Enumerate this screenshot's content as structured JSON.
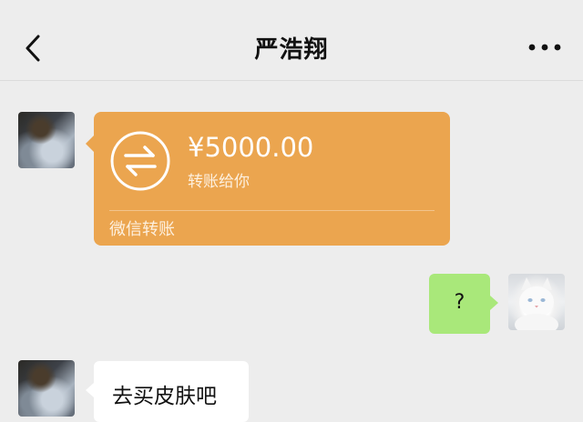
{
  "header": {
    "title": "严浩翔",
    "back_icon": "chevron-left-icon",
    "more_icon": "more-horizontal-icon"
  },
  "messages": [
    {
      "type": "transfer",
      "sender": "contact",
      "amount": "¥5000.00",
      "subtitle": "转账给你",
      "footer": "微信转账",
      "color": "#eba54f"
    },
    {
      "type": "text",
      "sender": "me",
      "text": "?",
      "color": "#a9e87a"
    },
    {
      "type": "text",
      "sender": "contact",
      "text": "去买皮肤吧",
      "color": "#ffffff"
    }
  ],
  "colors": {
    "background": "#ededed",
    "transfer_card": "#eba54f",
    "my_bubble": "#a9e87a",
    "contact_bubble": "#ffffff"
  }
}
